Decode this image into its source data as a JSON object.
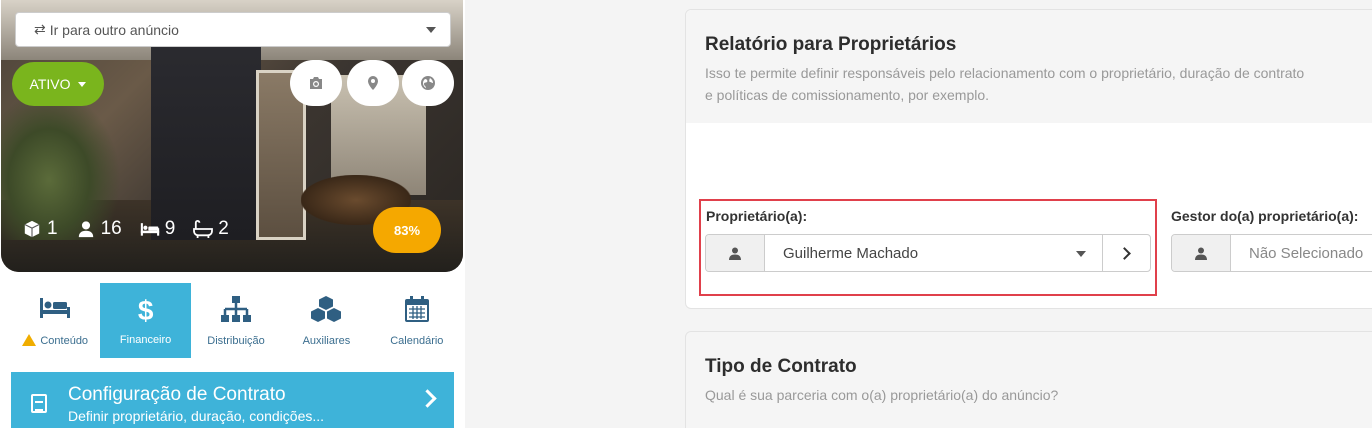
{
  "ad_selector": {
    "label": "Ir para outro anúncio"
  },
  "status": {
    "label": "ATIVO"
  },
  "stats": {
    "units": "1",
    "guests": "16",
    "beds": "9",
    "baths": "2"
  },
  "completion": "83%",
  "tabs": [
    {
      "label": "Conteúdo"
    },
    {
      "label": "Financeiro"
    },
    {
      "label": "Distribuição"
    },
    {
      "label": "Auxiliares"
    },
    {
      "label": "Calendário"
    }
  ],
  "config_card": {
    "title": "Configuração de Contrato",
    "subtitle": "Definir proprietário, duração, condições..."
  },
  "owner_report": {
    "title": "Relatório para Proprietários",
    "description": "Isso te permite definir responsáveis pelo relacionamento com o proprietário, duração de contrato e políticas de comissionamento, por exemplo.",
    "owner_label": "Proprietário(a):",
    "owner_value": "Guilherme Machado",
    "manager_label": "Gestor do(a) proprietário(a):",
    "manager_value": "Não Selecionado"
  },
  "contract_type": {
    "title": "Tipo de Contrato",
    "description": "Qual é sua parceria com o(a) proprietário(a) do anúncio?"
  },
  "colors": {
    "accent": "#3eb3d9",
    "active": "#7ab51d",
    "completion": "#f5a800",
    "highlight": "#e0404b"
  }
}
